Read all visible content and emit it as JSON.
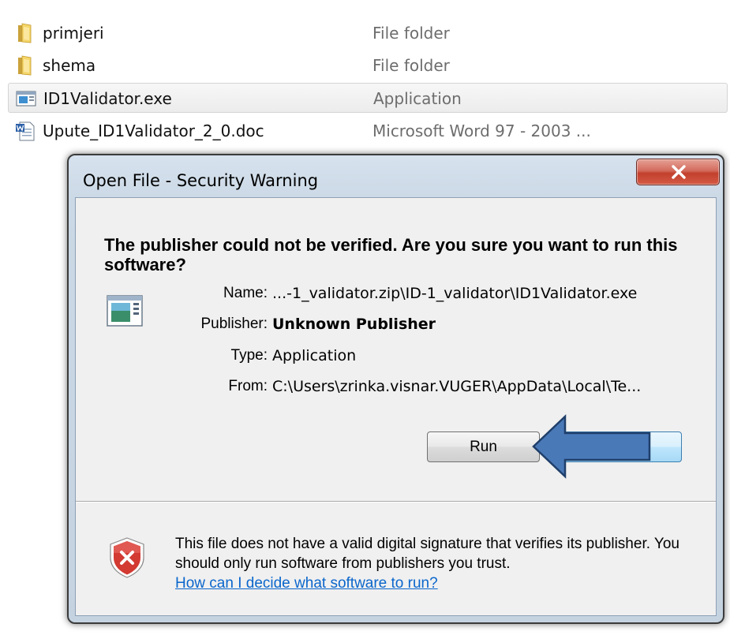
{
  "files": [
    {
      "name": "primjeri",
      "type": "File folder",
      "icon": "folder-icon"
    },
    {
      "name": "shema",
      "type": "File folder",
      "icon": "folder-icon"
    },
    {
      "name": "ID1Validator.exe",
      "type": "Application",
      "icon": "application-icon"
    },
    {
      "name": "Upute_ID1Validator_2_0.doc",
      "type": "Microsoft Word 97 - 2003 ...",
      "icon": "word-document-icon"
    }
  ],
  "dialog": {
    "title": "Open File - Security Warning",
    "headline": "The publisher could not be verified.  Are you sure you want to run this software?",
    "details": {
      "name_label": "Name:",
      "name_value": "...-1_validator.zip\\ID-1_validator\\ID1Validator.exe",
      "publisher_label": "Publisher:",
      "publisher_value": "Unknown Publisher",
      "type_label": "Type:",
      "type_value": "Application",
      "from_label": "From:",
      "from_value": "C:\\Users\\zrinka.visnar.VUGER\\AppData\\Local\\Te..."
    },
    "run_label": "Run",
    "cancel_label": "",
    "warning_text": "This file does not have a valid digital signature that verifies its publisher.  You should only run software from publishers you trust.",
    "help_link": "How can I decide what software to run?"
  },
  "colors": {
    "arrow_fill": "#4a79b8",
    "arrow_stroke": "#1f3f6a",
    "link": "#0a66cc",
    "close_red": "#c2402d"
  }
}
